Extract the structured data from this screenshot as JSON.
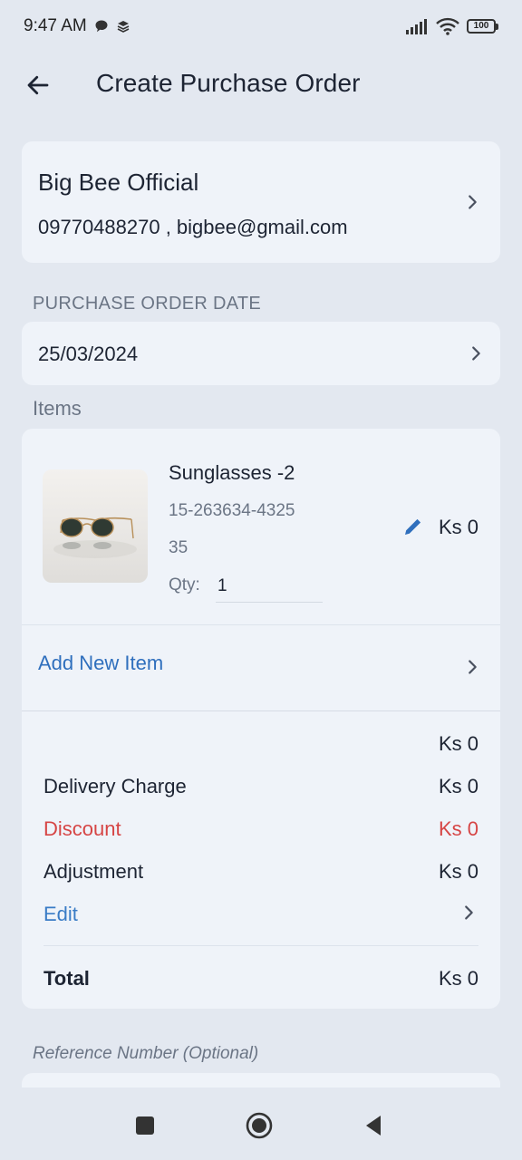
{
  "status_bar": {
    "time": "9:47 AM",
    "battery": "100",
    "icons": [
      "chat-bubble-icon",
      "stack-icon",
      "signal-icon",
      "wifi-icon",
      "battery-icon"
    ]
  },
  "header": {
    "title": "Create Purchase Order",
    "back_icon": "arrow-left-icon"
  },
  "vendor": {
    "name": "Big Bee Official",
    "contact": "09770488270 , bigbee@gmail.com"
  },
  "order_date": {
    "label": "PURCHASE ORDER DATE",
    "value": "25/03/2024"
  },
  "items": {
    "label": "Items",
    "list": [
      {
        "name": "Sunglasses -2",
        "sku": "15-263634-4325",
        "code": "35",
        "qty_label": "Qty:",
        "qty": "1",
        "price": "Ks 0",
        "image": "sunglasses-product-image"
      }
    ],
    "add_label": "Add New Item"
  },
  "summary": {
    "subtotal": "Ks 0",
    "delivery_label": "Delivery Charge",
    "delivery_value": "Ks 0",
    "discount_label": "Discount",
    "discount_value": "Ks 0",
    "adjustment_label": "Adjustment",
    "adjustment_value": "Ks 0",
    "edit_label": "Edit",
    "total_label": "Total",
    "total_value": "Ks 0"
  },
  "reference": {
    "placeholder": "Reference Number (Optional)"
  },
  "colors": {
    "background": "#e3e8f0",
    "card": "#eff3f9",
    "accent_blue": "#2f6fbd",
    "discount_red": "#d64545",
    "muted_text": "#6b7585"
  }
}
